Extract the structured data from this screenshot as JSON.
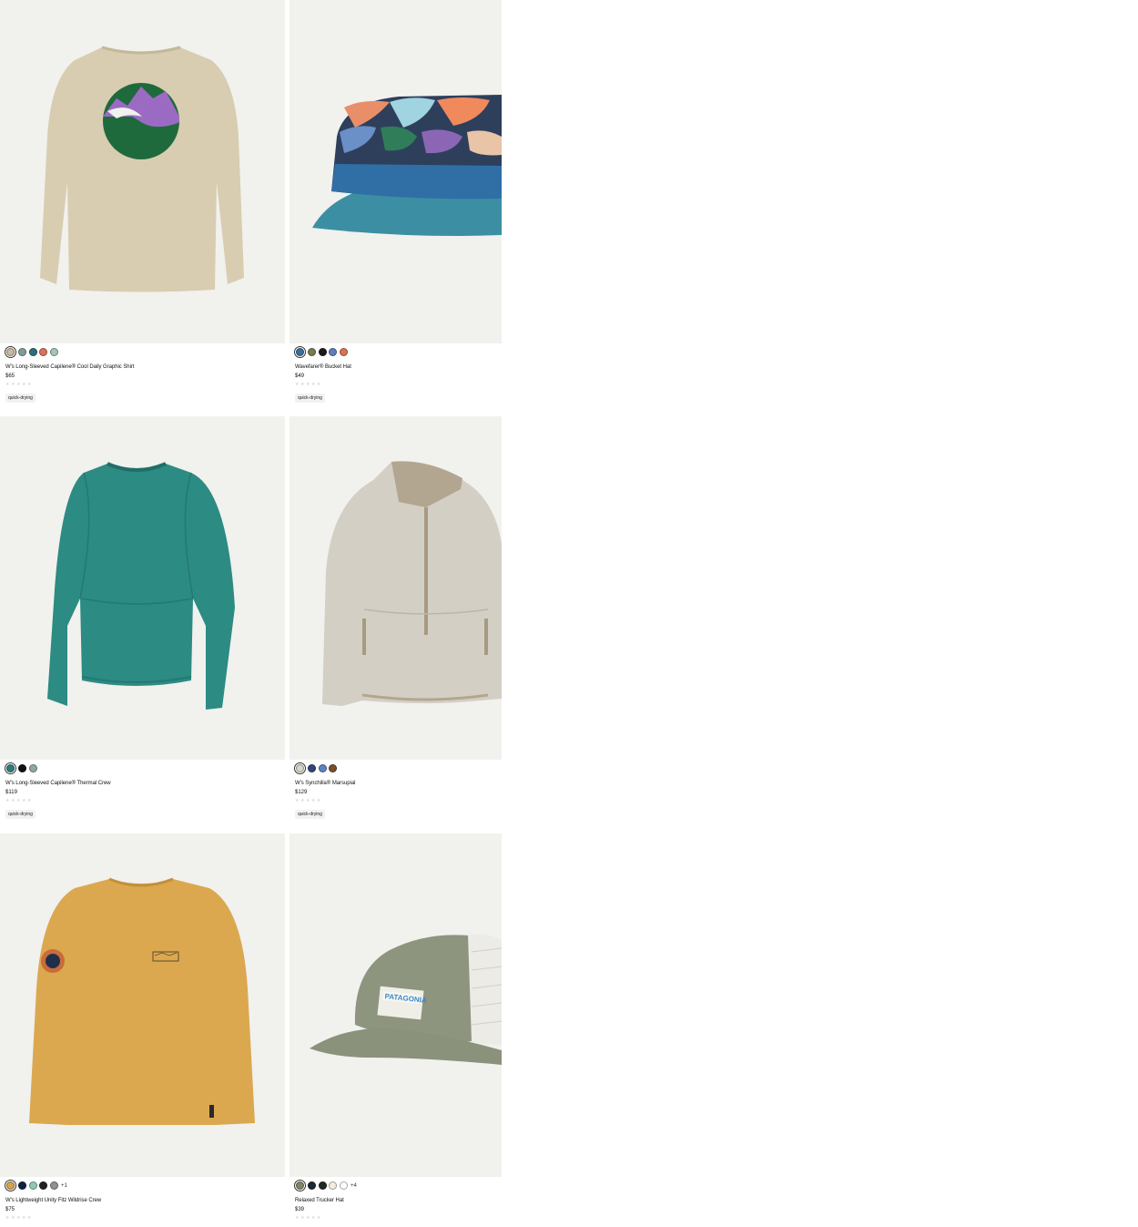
{
  "products": [
    {
      "name": "W's Long-Sleeved Capilene® Cool Daily Graphic Shirt",
      "price": "$65",
      "stars": "★★★★★",
      "badge": "quick-drying",
      "image": "womens-long-sleeve-graphic-shirt-back-mountain-wave-logo",
      "swatches": [
        "#c9b99a",
        "#7f9f97",
        "#2f6f78",
        "#d9735c",
        "#9fc8b2"
      ],
      "more": ""
    },
    {
      "name": "Wavefarer® Bucket Hat",
      "price": "$49",
      "stars": "★★★★★",
      "badge": "quick-drying",
      "image": "patterned-bucket-hat-blue-brim",
      "swatches": [
        "#3b6f9a",
        "#7c7a52",
        "#1b1b1b",
        "#5f7fb8",
        "#d77355"
      ],
      "more": ""
    },
    {
      "name": "W's Long-Sleeved Capilene® Thermal Crew",
      "price": "$119",
      "stars": "★★★★★",
      "badge": "quick-drying",
      "image": "teal-thermal-crew-shirt",
      "swatches": [
        "#2b7e7a",
        "#111111",
        "#8fa8a6"
      ],
      "more": ""
    },
    {
      "name": "W's Synchilla® Marsupial",
      "price": "$129",
      "stars": "★★★★★",
      "badge": "quick-drying",
      "image": "oatmeal-fleece-half-zip-pullover",
      "swatches": [
        "#d9d5cb",
        "#34457a",
        "#5c85bf",
        "#7a4f2a"
      ],
      "more": ""
    },
    {
      "name": "W's Lightweight Unity Fitz Wildrise Crew",
      "price": "$75",
      "stars": "★★★★★",
      "badge": "",
      "image": "mustard-crew-sweatshirt-with-patch",
      "swatches": [
        "#d9a446",
        "#0f2244",
        "#93c9b4",
        "#222222",
        "#8e9393"
      ],
      "more": "+1"
    },
    {
      "name": "Relaxed Trucker Hat",
      "price": "$39",
      "stars": "★★★★★",
      "badge": "",
      "image": "sage-trucker-hat-patagonia-patch",
      "swatches": [
        "#7d8768",
        "#1c2a36",
        "#1f2c26",
        "#f3efdc",
        "#ffffff"
      ],
      "more": "+4"
    }
  ],
  "hat_patch_text": "PATAGONIA"
}
